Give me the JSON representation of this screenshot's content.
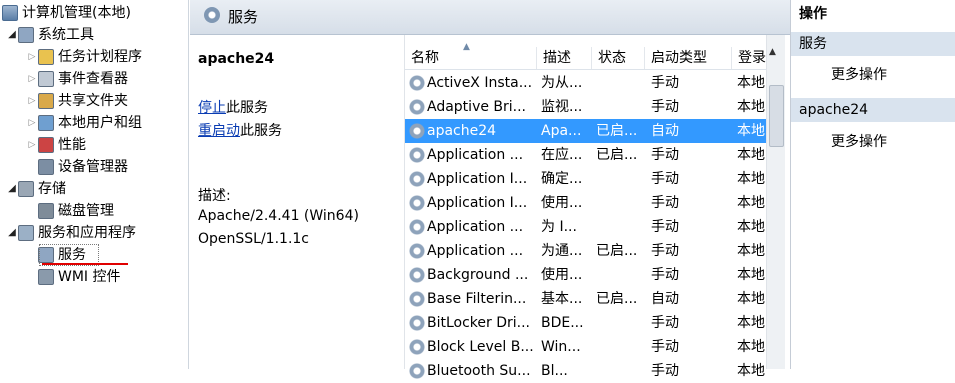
{
  "tree": {
    "root": "计算机管理(本地)",
    "items": [
      {
        "label": "系统工具",
        "level": 1,
        "state": "open"
      },
      {
        "label": "任务计划程序",
        "level": 2,
        "state": "closed"
      },
      {
        "label": "事件查看器",
        "level": 2,
        "state": "closed"
      },
      {
        "label": "共享文件夹",
        "level": 2,
        "state": "closed"
      },
      {
        "label": "本地用户和组",
        "level": 2,
        "state": "closed"
      },
      {
        "label": "性能",
        "level": 2,
        "state": "closed"
      },
      {
        "label": "设备管理器",
        "level": 2,
        "state": "none"
      },
      {
        "label": "存储",
        "level": 1,
        "state": "open"
      },
      {
        "label": "磁盘管理",
        "level": 2,
        "state": "none"
      },
      {
        "label": "服务和应用程序",
        "level": 1,
        "state": "open"
      },
      {
        "label": "服务",
        "level": 2,
        "state": "none",
        "selected": true
      },
      {
        "label": "WMI 控件",
        "level": 2,
        "state": "none"
      }
    ]
  },
  "header": {
    "title": "服务"
  },
  "detail": {
    "name": "apache24",
    "stop_link": "停止",
    "stop_suffix": "此服务",
    "restart_link": "重启动",
    "restart_suffix": "此服务",
    "desc_label": "描述:",
    "desc_lines": [
      "Apache/2.4.41 (Win64)",
      "OpenSSL/1.1.1c"
    ]
  },
  "columns": [
    "名称",
    "描述",
    "状态",
    "启动类型",
    "登录"
  ],
  "rows": [
    [
      "ActiveX Insta...",
      "为从...",
      "",
      "手动",
      "本地"
    ],
    [
      "Adaptive Bri...",
      "监视...",
      "",
      "手动",
      "本地"
    ],
    [
      "apache24",
      "Apa...",
      "已启...",
      "自动",
      "本地"
    ],
    [
      "Application ...",
      "在应...",
      "已启...",
      "手动",
      "本地"
    ],
    [
      "Application I...",
      "确定...",
      "",
      "手动",
      "本地"
    ],
    [
      "Application I...",
      "使用...",
      "",
      "手动",
      "本地"
    ],
    [
      "Application ...",
      "为 I...",
      "",
      "手动",
      "本地"
    ],
    [
      "Application ...",
      "为通...",
      "已启...",
      "手动",
      "本地"
    ],
    [
      "Background ...",
      "使用...",
      "",
      "手动",
      "本地"
    ],
    [
      "Base Filterin...",
      "基本...",
      "已启...",
      "自动",
      "本地"
    ],
    [
      "BitLocker Dri...",
      "BDE...",
      "",
      "手动",
      "本地"
    ],
    [
      "Block Level B...",
      "Win...",
      "",
      "手动",
      "本地"
    ],
    [
      "Bluetooth Su...",
      "Bl...",
      "",
      "手动",
      "本地"
    ]
  ],
  "selected_row": 2,
  "actions": {
    "title": "操作",
    "section1": "服务",
    "section1_item": "更多操作",
    "section2": "apache24",
    "section2_item": "更多操作"
  },
  "colors": {
    "selection": "#3399ff",
    "link": "#0a3cb3",
    "underline": "#e00000",
    "section_bg": "#d9e3ee"
  }
}
